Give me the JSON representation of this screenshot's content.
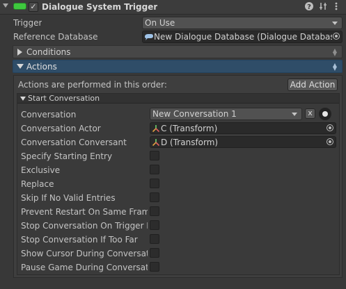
{
  "component": {
    "title": "Dialogue System Trigger",
    "enabled": true,
    "icons": [
      "help-icon",
      "preset-icon",
      "more-icon"
    ]
  },
  "trigger": {
    "label": "Trigger",
    "value": "On Use"
  },
  "reference_database": {
    "label": "Reference Database",
    "value": "New Dialogue Database (Dialogue Database)"
  },
  "sections": {
    "conditions": {
      "label": "Conditions"
    },
    "actions": {
      "label": "Actions"
    }
  },
  "actions_panel": {
    "order_text": "Actions are performed in this order:",
    "add_action_label": "Add Action",
    "start_conversation": {
      "title": "Start Conversation",
      "conversation": {
        "label": "Conversation",
        "value": "New Conversation 1",
        "clear_label": "x"
      },
      "actor": {
        "label": "Conversation Actor",
        "value": "C (Transform)"
      },
      "conversant": {
        "label": "Conversation Conversant",
        "value": "D (Transform)"
      },
      "toggles": [
        {
          "label": "Specify Starting Entry",
          "checked": false
        },
        {
          "label": "Exclusive",
          "checked": false
        },
        {
          "label": "Replace",
          "checked": false
        },
        {
          "label": "Skip If No Valid Entries",
          "checked": false
        },
        {
          "label": "Prevent Restart On Same Frame",
          "checked": false
        },
        {
          "label": "Stop Conversation On Trigger Ex",
          "checked": false
        },
        {
          "label": "Stop Conversation If Too Far",
          "checked": false
        },
        {
          "label": "Show Cursor During Conversatio",
          "checked": false
        },
        {
          "label": "Pause Game During Conversatio",
          "checked": false
        }
      ]
    }
  }
}
